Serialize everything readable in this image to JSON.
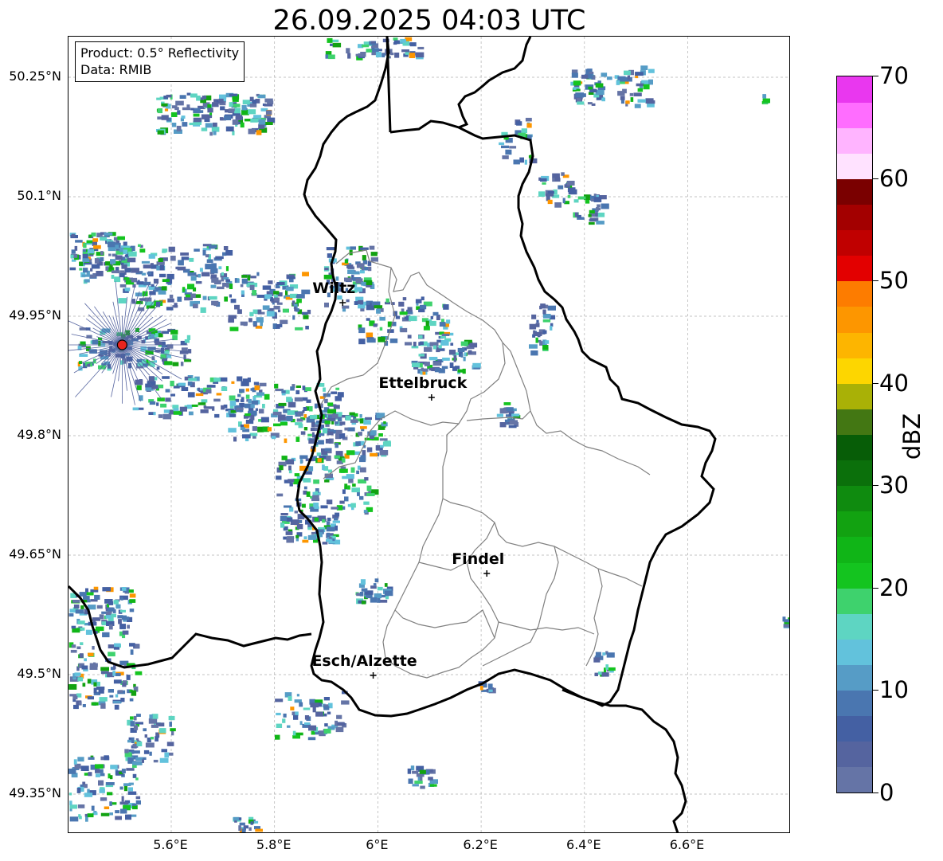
{
  "title": "26.09.2025 04:03 UTC",
  "info": {
    "product": "Product: 0.5° Reflectivity",
    "data_source": "Data: RMIB"
  },
  "map": {
    "lon_range": [
      5.4,
      6.8
    ],
    "lat_range": [
      49.3,
      50.3
    ],
    "lat_ticks": [
      {
        "value": 50.25,
        "label": "50.25°N"
      },
      {
        "value": 50.1,
        "label": "50.1°N"
      },
      {
        "value": 49.95,
        "label": "49.95°N"
      },
      {
        "value": 49.8,
        "label": "49.8°N"
      },
      {
        "value": 49.65,
        "label": "49.65°N"
      },
      {
        "value": 49.5,
        "label": "49.5°N"
      },
      {
        "value": 49.35,
        "label": "49.35°N"
      }
    ],
    "lon_ticks": [
      {
        "value": 5.6,
        "label": "5.6°E"
      },
      {
        "value": 5.8,
        "label": "5.8°E"
      },
      {
        "value": 6.0,
        "label": "6°E"
      },
      {
        "value": 6.2,
        "label": "6.2°E"
      },
      {
        "value": 6.4,
        "label": "6.4°E"
      },
      {
        "value": 6.6,
        "label": "6.6°E"
      }
    ],
    "gridlines": true,
    "radar_site": {
      "lon": 5.505,
      "lat": 49.914
    },
    "cities": [
      {
        "name": "Wiltz",
        "lon": 5.932,
        "lat": 49.967
      },
      {
        "name": "Ettelbruck",
        "lon": 6.104,
        "lat": 49.848
      },
      {
        "name": "Findel",
        "lon": 6.211,
        "lat": 49.627
      },
      {
        "name": "Esch/Alzette",
        "lon": 5.991,
        "lat": 49.499
      }
    ]
  },
  "colorbar": {
    "label": "dBZ",
    "min": 0,
    "max": 70,
    "step": 2.5,
    "ticks": [
      {
        "value": 0,
        "label": "0"
      },
      {
        "value": 10,
        "label": "10"
      },
      {
        "value": 20,
        "label": "20"
      },
      {
        "value": 30,
        "label": "30"
      },
      {
        "value": 40,
        "label": "40"
      },
      {
        "value": 50,
        "label": "50"
      },
      {
        "value": 60,
        "label": "60"
      },
      {
        "value": 70,
        "label": "70"
      }
    ],
    "colors": [
      "#6574a6",
      "#55649f",
      "#4460a3",
      "#4a76b0",
      "#569cc6",
      "#62c2dc",
      "#5ed5c2",
      "#3ed26d",
      "#14c41f",
      "#10b517",
      "#12a211",
      "#0f8b0f",
      "#0b700b",
      "#075d07",
      "#437713",
      "#a9b106",
      "#fdd600",
      "#fdb500",
      "#fd9600",
      "#fd7c00",
      "#e30000",
      "#c00000",
      "#a30000",
      "#7a0000",
      "#ffe2ff",
      "#ffb4ff",
      "#ff6dff",
      "#e937ef"
    ]
  }
}
